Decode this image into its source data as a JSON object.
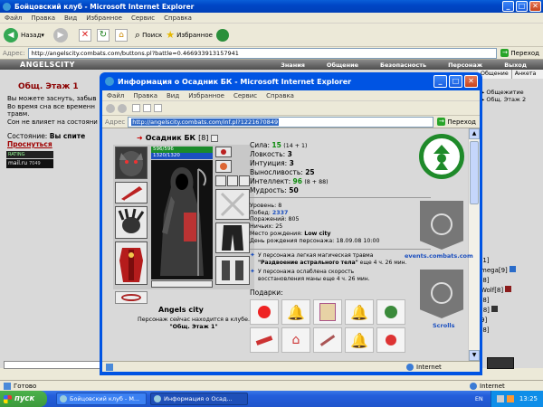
{
  "bg_window": {
    "title": "Бойцовский клуб - Microsoft Internet Explorer",
    "menu": [
      "Файл",
      "Правка",
      "Вид",
      "Избранное",
      "Сервис",
      "Справка"
    ],
    "toolbar": {
      "back": "Назад",
      "search": "Поиск",
      "favorites": "Избранное"
    },
    "address_label": "Адрес:",
    "address_value": "http://angelscity.combats.com/buttons.pl?battle=0.466933913157941",
    "go_label": "Переход",
    "logo_text": "ANGELSCITY",
    "nav": [
      "Знания",
      "Общение",
      "Безопасность",
      "Персонаж",
      "Выход"
    ],
    "location": "Общ. Этаж 1",
    "messages": [
      "Вы можете заснуть, забыв",
      "Во время сна все временн",
      "травм.",
      "Сон не влияет на состояни"
    ],
    "state_label": "Состояние:",
    "state_value": "Вы спите",
    "wake_link": "Проснуться",
    "counter1": "6496126745",
    "counter2_label": "mail.ru",
    "counter2": "7049",
    "right_tabs": [
      "Общение",
      "Анкета"
    ],
    "right_list": [
      "Общежитие",
      "Общ. Этаж 2"
    ],
    "chat": [
      "|1]",
      "mega[9]",
      "|8]",
      "Wolf[8]",
      "|8]",
      "[8]",
      "9]",
      "|8]"
    ],
    "status_text": "Готово",
    "status_zone": "Internet"
  },
  "fg_window": {
    "title": "Информация о Осадник БК - Microsoft Internet Explorer",
    "menu": [
      "Файл",
      "Правка",
      "Вид",
      "Избранное",
      "Сервис",
      "Справка"
    ],
    "address_label": "Адрес",
    "address_value": "http://angelscity.combats.com/inf.pl?1221670849",
    "go_label": "Переход",
    "status_zone": "Internet"
  },
  "character": {
    "name": "Осадник БК",
    "level": "[8]",
    "hp": "596/596",
    "mana": "1320/1320",
    "city": "Angels city",
    "presence": "Персонаж сейчас находится в клубе.",
    "location": "\"Общ. Этаж 1\""
  },
  "stats": [
    {
      "label": "Сила:",
      "value": "15",
      "bonus": "(14 + 1)"
    },
    {
      "label": "Ловкость:",
      "value": "3",
      "bonus": ""
    },
    {
      "label": "Интуиция:",
      "value": "3",
      "bonus": ""
    },
    {
      "label": "Выносливость:",
      "value": "25",
      "bonus": ""
    },
    {
      "label": "Интеллект:",
      "value": "96",
      "bonus": "(8 + 88)"
    },
    {
      "label": "Мудрость:",
      "value": "50",
      "bonus": ""
    }
  ],
  "info": [
    {
      "label": "Уровень:",
      "value": "8"
    },
    {
      "label": "Побед:",
      "value": "2337"
    },
    {
      "label": "Поражений:",
      "value": "805"
    },
    {
      "label": "Ничьих:",
      "value": "25"
    },
    {
      "label": "Место рождения:",
      "value": "Low city"
    },
    {
      "label": "День рождения персонажа:",
      "value": "18.09.08 10:00"
    }
  ],
  "effects": [
    {
      "line1": "У персонажа легкая магическая травма",
      "line2": "\"Раздвоение астрального тела\"",
      "line3": " еще 4 ч. 26 мин."
    },
    {
      "line1": "У персонажа ослаблена скорость",
      "line2": "восстановления маны",
      "line3": " еще 4 ч. 26 мин."
    }
  ],
  "gifts_label": "Подарки:",
  "side_links": [
    "events.combats.com",
    "Scrolls"
  ],
  "taskbar": {
    "start": "пуск",
    "tasks": [
      "Бойцовский клуб - М...",
      "Информация о Осад..."
    ],
    "lang": "EN",
    "clock": "13:25"
  },
  "colors": {
    "xp_blue": "#0054e3",
    "stat_green": "#0a8a0a",
    "taskbar": "#245edb",
    "start": "#3c9a3c"
  }
}
